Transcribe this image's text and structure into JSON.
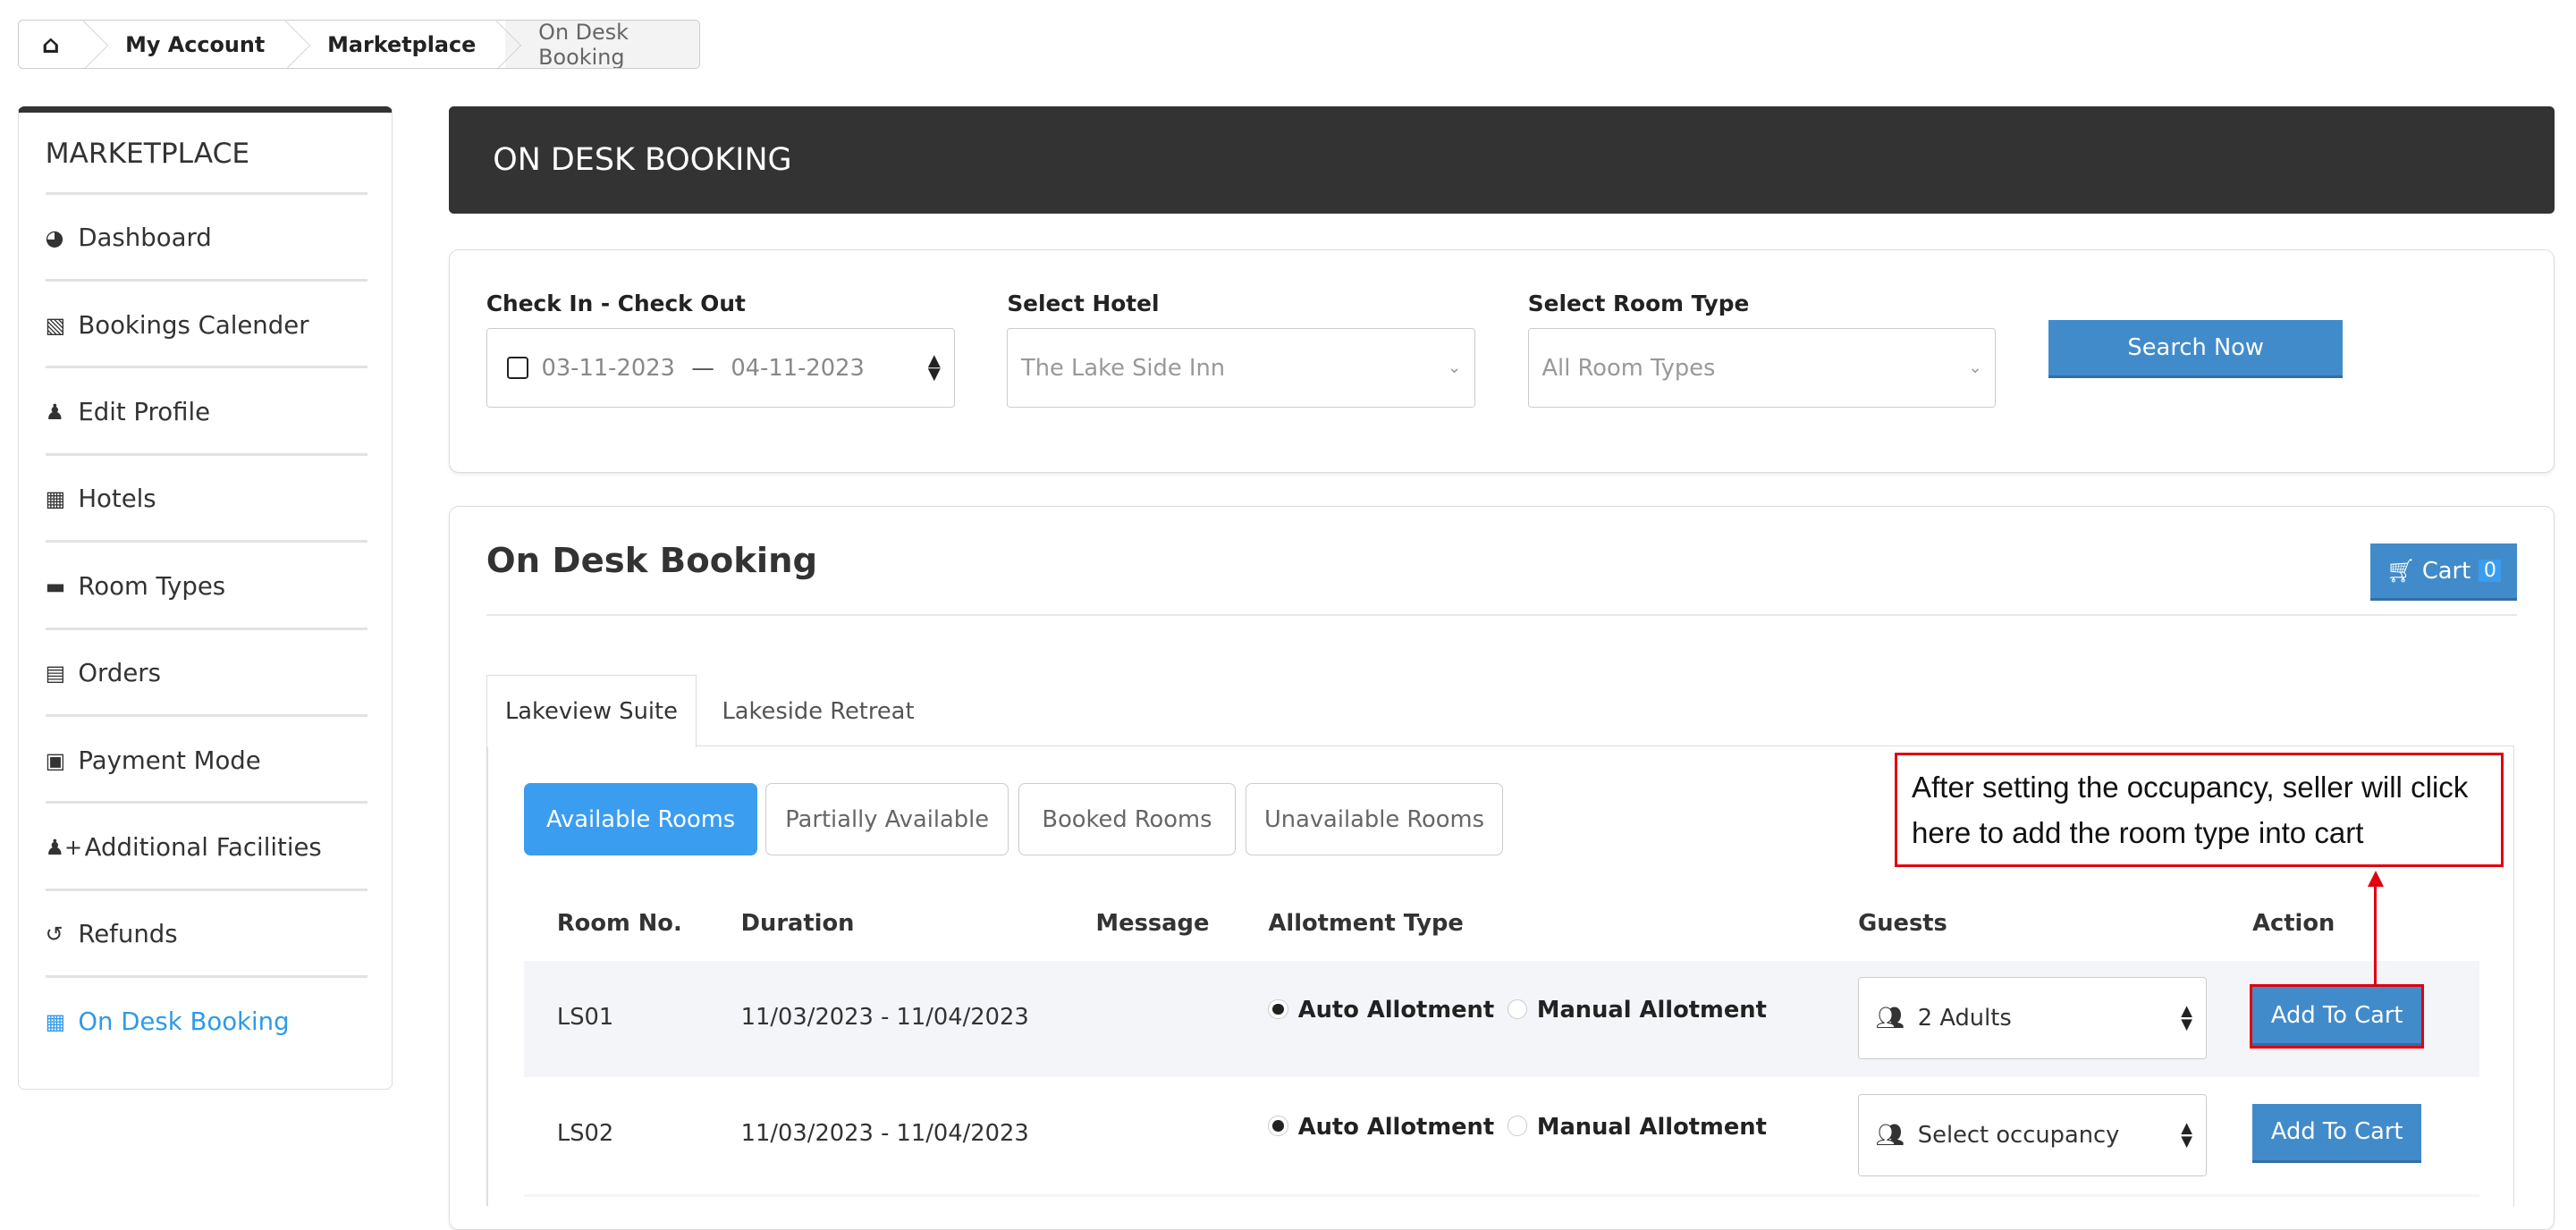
{
  "breadcrumb": {
    "home_icon": "home-icon",
    "items": [
      "My Account",
      "Marketplace",
      "On Desk Booking"
    ]
  },
  "sidebar": {
    "title": "MARKETPLACE",
    "items": [
      {
        "label": "Dashboard",
        "icon": "dashboard-icon"
      },
      {
        "label": "Bookings Calender",
        "icon": "bar-chart-icon"
      },
      {
        "label": "Edit Profile",
        "icon": "user-icon"
      },
      {
        "label": "Hotels",
        "icon": "building-icon"
      },
      {
        "label": "Room Types",
        "icon": "bed-icon"
      },
      {
        "label": "Orders",
        "icon": "credit-card-icon"
      },
      {
        "label": "Payment Mode",
        "icon": "money-icon"
      },
      {
        "label": "Additional Facilities",
        "icon": "user-plus-icon"
      },
      {
        "label": "Refunds",
        "icon": "undo-icon"
      },
      {
        "label": "On Desk Booking",
        "icon": "calendar-icon",
        "active": true
      }
    ]
  },
  "header": {
    "title": "ON DESK BOOKING"
  },
  "search": {
    "dates_label": "Check In - Check Out",
    "check_in": "03-11-2023",
    "check_out": "04-11-2023",
    "hotel_label": "Select Hotel",
    "hotel_value": "The Lake Side Inn",
    "room_type_label": "Select Room Type",
    "room_type_value": "All Room Types",
    "search_button": "Search Now"
  },
  "booking": {
    "title": "On Desk Booking",
    "cart_label": "Cart",
    "cart_count": "0",
    "tabs": [
      "Lakeview Suite",
      "Lakeside Retreat"
    ],
    "filters": [
      "Available Rooms",
      "Partially Available",
      "Booked Rooms",
      "Unavailable Rooms"
    ],
    "columns": [
      "Room No.",
      "Duration",
      "Message",
      "Allotment Type",
      "Guests",
      "Action"
    ],
    "rows": [
      {
        "room": "LS01",
        "duration": "11/03/2023 - 11/04/2023",
        "message": "",
        "auto": "Auto Allotment",
        "manual": "Manual Allotment",
        "guests": "2 Adults",
        "action": "Add To Cart"
      },
      {
        "room": "LS02",
        "duration": "11/03/2023 - 11/04/2023",
        "message": "",
        "auto": "Auto Allotment",
        "manual": "Manual Allotment",
        "guests": "Select occupancy",
        "action": "Add To Cart"
      }
    ]
  },
  "annotation": {
    "text": "After setting the occupancy, seller will click here to add the room type into cart",
    "color": "#e0000f"
  },
  "colors": {
    "primary": "#428bca",
    "active_filter": "#3a9df0",
    "header_bg": "#333333",
    "active_link": "#2e9ae8"
  }
}
